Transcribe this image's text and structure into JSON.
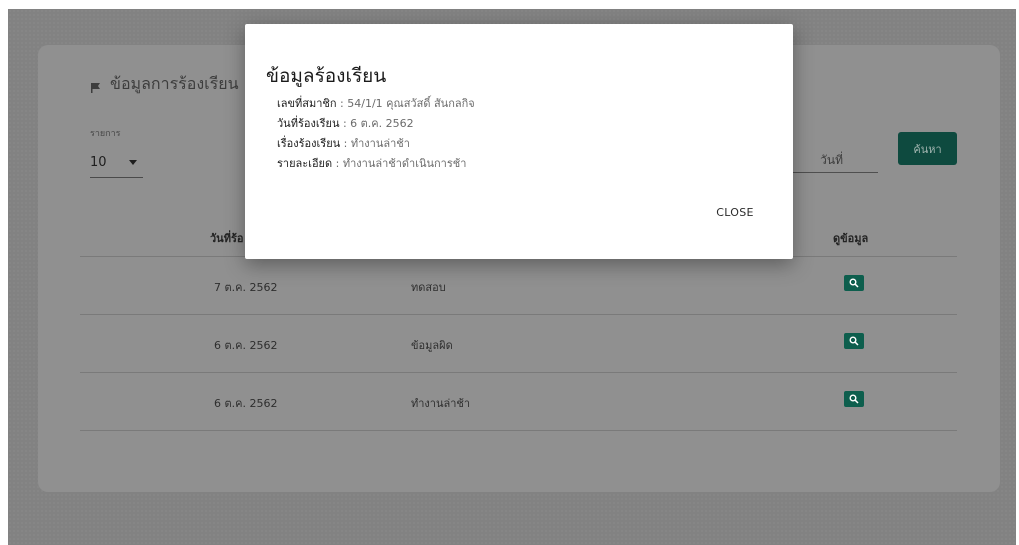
{
  "card": {
    "title": "ข้อมูลการร้องเรียน",
    "per_page_label": "รายการ",
    "per_page_value": "10",
    "search_placeholder": "วันที่",
    "search_button": "ค้นหา"
  },
  "table": {
    "headers": {
      "date": "วันที่ร้อ",
      "view": "ดูข้อมูล"
    },
    "rows": [
      {
        "date": "7 ต.ค. 2562",
        "subject": "ทดสอบ"
      },
      {
        "date": "6 ต.ค. 2562",
        "subject": "ข้อมูลผิด"
      },
      {
        "date": "6 ต.ค. 2562",
        "subject": "ทำงานล่าช้า"
      }
    ],
    "view_icon": "search-icon"
  },
  "modal": {
    "title": "ข้อมูลร้องเรียน",
    "details": [
      {
        "label": "เลขที่สมาชิก",
        "value": "54/1/1 คุณสวัสดิ์ สันกลกิจ"
      },
      {
        "label": "วันที่ร้องเรียน",
        "value": "6 ต.ค. 2562"
      },
      {
        "label": "เรื่องร้องเรียน",
        "value": "ทำงานล่าช้า"
      },
      {
        "label": "รายละเอียด",
        "value": "ทำงานล่าช้าดำเนินการช้า"
      }
    ],
    "close_label": "CLOSE"
  },
  "colors": {
    "accent": "#1a8f78",
    "overlay": "#828282",
    "modal_bg": "#ffffff"
  }
}
